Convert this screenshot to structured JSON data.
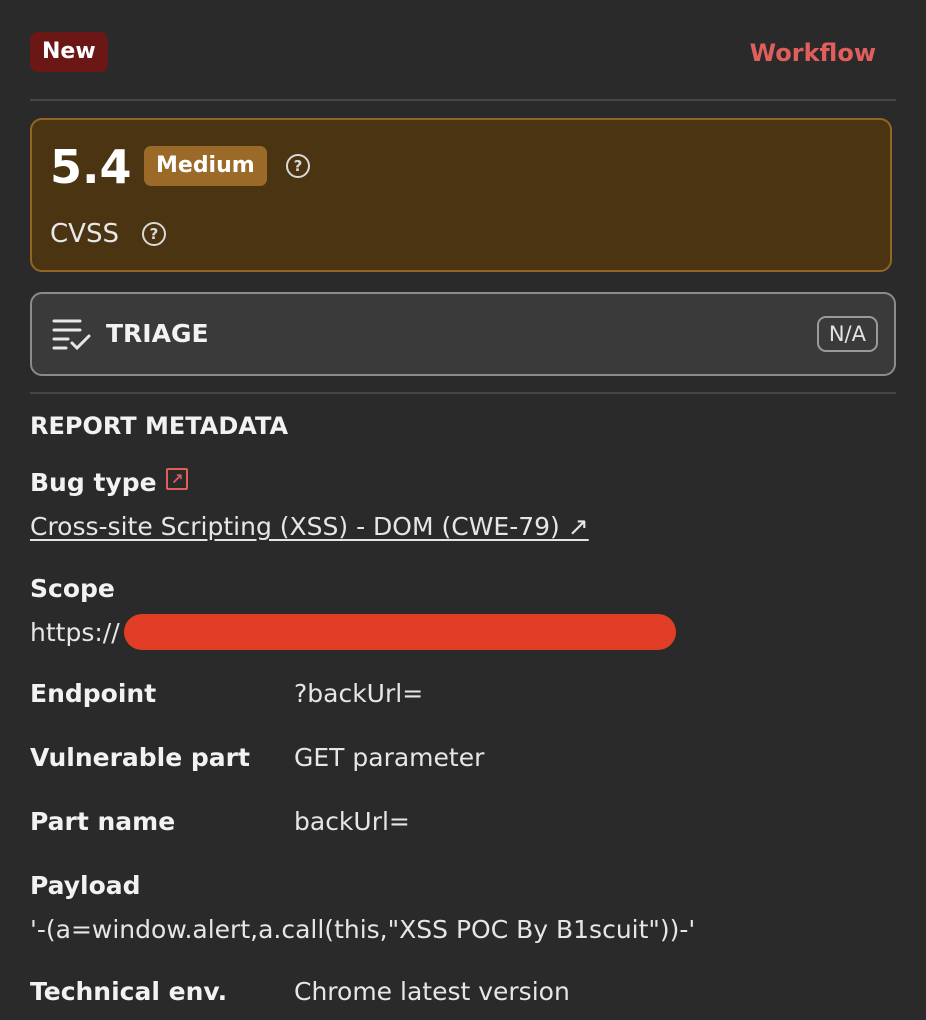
{
  "header": {
    "status": "New",
    "workflow_label": "Workflow"
  },
  "cvss": {
    "score": "5.4",
    "severity": "Medium",
    "label": "CVSS",
    "help_glyph": "?"
  },
  "triage": {
    "title": "TRIAGE",
    "value": "N/A",
    "icon": "list-check-icon"
  },
  "metadata": {
    "section_title": "REPORT METADATA",
    "bug_type": {
      "label": "Bug type",
      "value": "Cross-site Scripting (XSS) - DOM (CWE-79) ↗",
      "icon_glyph": "↗"
    },
    "scope": {
      "label": "Scope",
      "value": "https://"
    },
    "endpoint": {
      "label": "Endpoint",
      "value": "?backUrl="
    },
    "vulnerable_part": {
      "label": "Vulnerable part",
      "value": "GET parameter"
    },
    "part_name": {
      "label": "Part name",
      "value": "backUrl="
    },
    "payload": {
      "label": "Payload",
      "value": "'-(a=window.alert,a.call(this,\"XSS POC By B1scuit\"))-'"
    },
    "technical_env": {
      "label": "Technical env.",
      "value": "Chrome latest version"
    }
  },
  "colors": {
    "background": "#2a2a2b",
    "accent": "#e05f5c",
    "status_new": "#6b1716",
    "severity_medium": "#9b6a28",
    "cvss_card": "#4a3412",
    "redaction": "#e23d26"
  }
}
